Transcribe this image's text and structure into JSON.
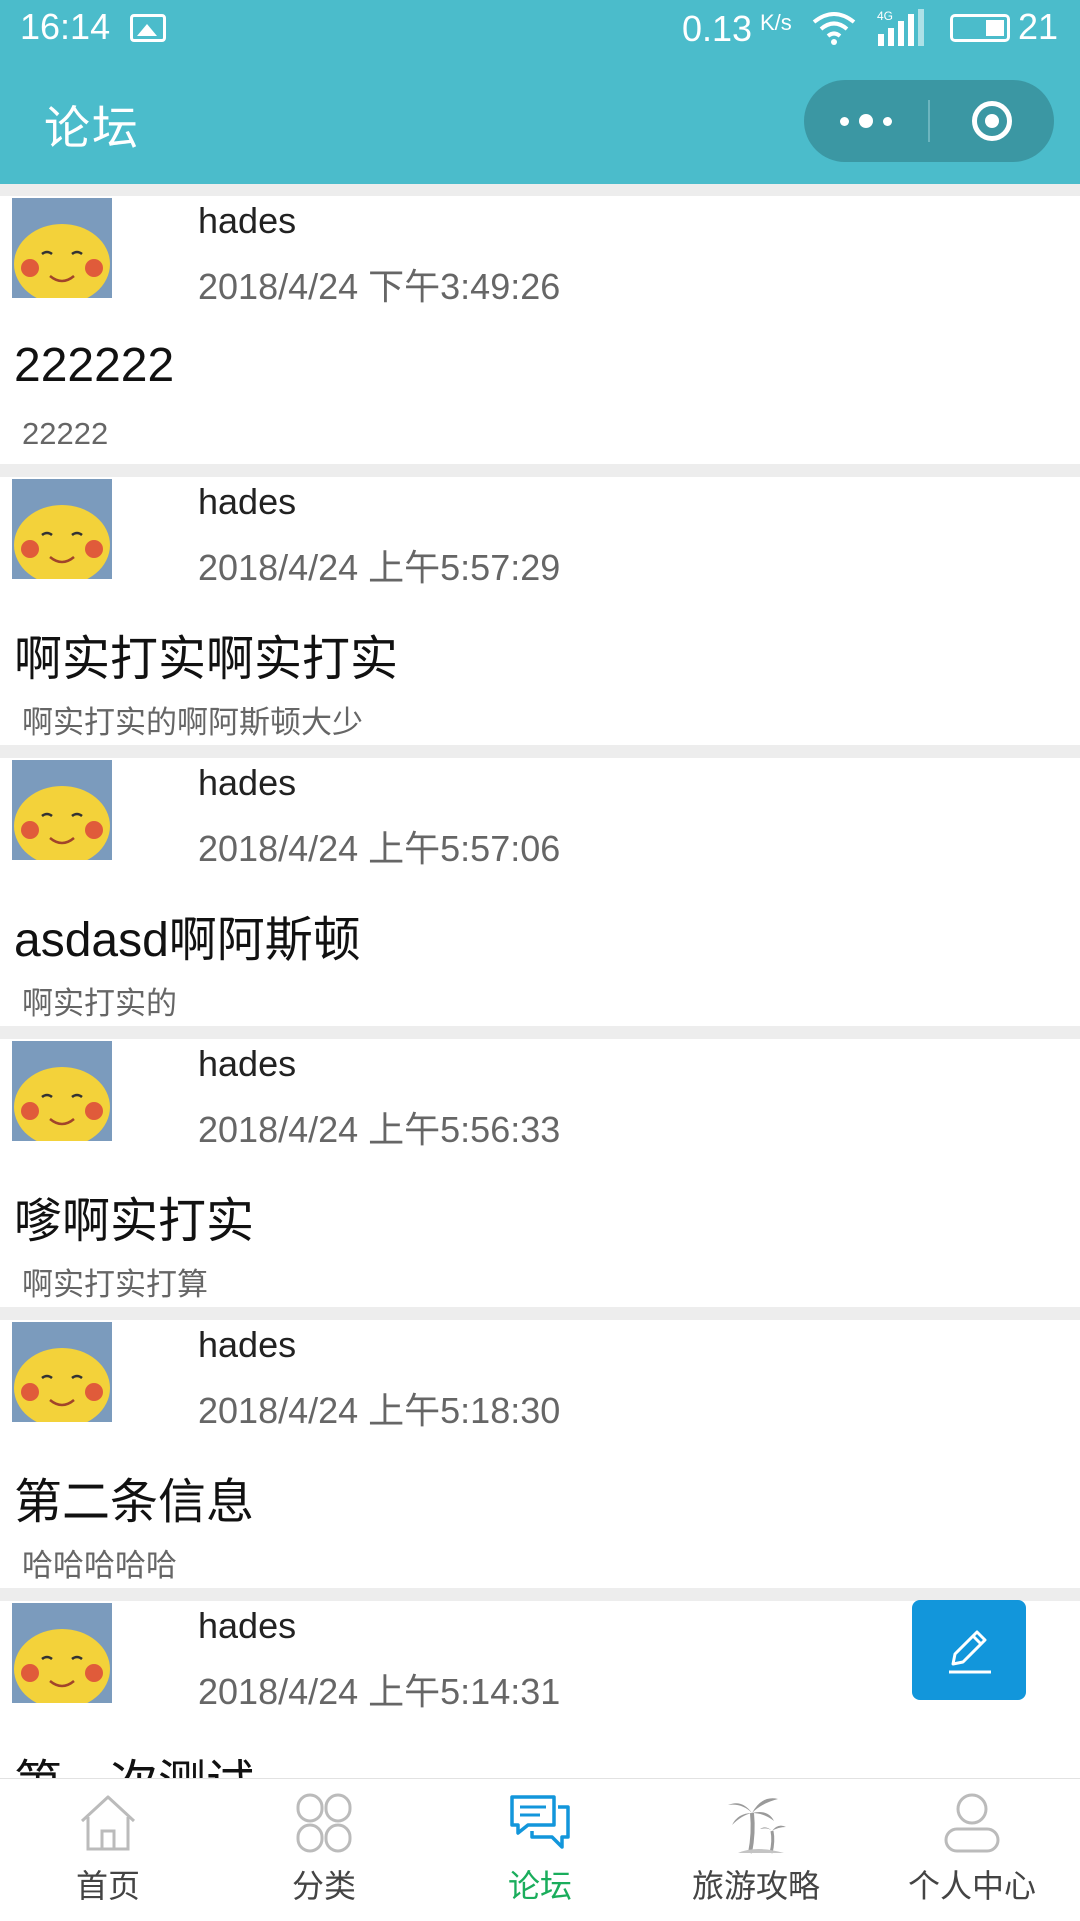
{
  "status_bar": {
    "time": "16:14",
    "net_speed": "0.13",
    "net_speed_unit": "K/s",
    "signal_type": "4G",
    "battery_level": "21"
  },
  "nav": {
    "title": "论坛"
  },
  "posts": [
    {
      "author": "hades",
      "date": "2018/4/24 下午3:49:26",
      "title": "222222",
      "body": "22222"
    },
    {
      "author": "hades",
      "date": "2018/4/24 上午5:57:29",
      "title": "啊实打实啊实打实",
      "body": "啊实打实的啊阿斯顿大少"
    },
    {
      "author": "hades",
      "date": "2018/4/24 上午5:57:06",
      "title": "asdasd啊阿斯顿",
      "body": "啊实打实的"
    },
    {
      "author": "hades",
      "date": "2018/4/24 上午5:56:33",
      "title": "嗲啊实打实",
      "body": "啊实打实打算"
    },
    {
      "author": "hades",
      "date": "2018/4/24 上午5:18:30",
      "title": "第二条信息",
      "body": "哈哈哈哈哈"
    },
    {
      "author": "hades",
      "date": "2018/4/24 上午5:14:31",
      "title": "第一次测试",
      "body": ""
    }
  ],
  "tabs": [
    {
      "label": "首页",
      "icon": "home-icon"
    },
    {
      "label": "分类",
      "icon": "category-icon"
    },
    {
      "label": "论坛",
      "icon": "forum-icon",
      "active": true
    },
    {
      "label": "旅游攻略",
      "icon": "palm-tree-icon"
    },
    {
      "label": "个人中心",
      "icon": "user-icon"
    }
  ],
  "colors": {
    "header": "#4bbccb",
    "capsule": "#3b97a3",
    "fab": "#1296db",
    "tab_active": "#1aad5c"
  }
}
